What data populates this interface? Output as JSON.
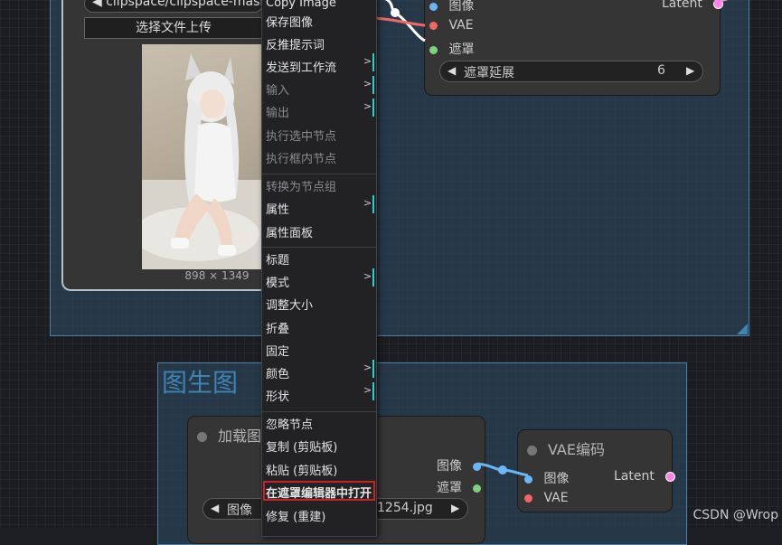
{
  "top_group": {
    "load_node": {
      "file_select": "◀ clipspace/clipspace-mask-",
      "upload_button": "选择文件上传",
      "image_size": "898 × 1349"
    }
  },
  "mask_node": {
    "slot_image": "图像",
    "slot_vae": "VAE",
    "slot_mask": "遮罩",
    "output_latent": "Latent",
    "widget": {
      "label": "遮罩延展",
      "value": "6"
    }
  },
  "bottom_group": {
    "title": "图生图",
    "load_node": {
      "title": "加载图",
      "out_image": "图像",
      "out_mask": "遮罩",
      "image_widget_label": "图像",
      "image_widget_value": "1254.jpg"
    },
    "vae_node": {
      "title": "VAE编码",
      "in_image": "图像",
      "in_vae": "VAE",
      "out_latent": "Latent"
    }
  },
  "context_menu": {
    "items": [
      {
        "label": "Copy Image",
        "disabled": false,
        "submenu": false
      },
      {
        "label": "保存图像",
        "disabled": false,
        "submenu": false
      },
      {
        "label": "反推提示词",
        "disabled": false,
        "submenu": false
      },
      {
        "label": "发送到工作流",
        "disabled": false,
        "submenu": true
      },
      {
        "label": "输入",
        "disabled": true,
        "submenu": true
      },
      {
        "label": "输出",
        "disabled": true,
        "submenu": true
      },
      {
        "label": "执行选中节点",
        "disabled": true,
        "submenu": false
      },
      {
        "label": "执行框内节点",
        "disabled": true,
        "submenu": false
      },
      {
        "label": "转换为节点组",
        "disabled": true,
        "submenu": false
      },
      {
        "label": "属性",
        "disabled": false,
        "submenu": true
      },
      {
        "label": "属性面板",
        "disabled": false,
        "submenu": false
      },
      {
        "label": "标题",
        "disabled": false,
        "submenu": false
      },
      {
        "label": "模式",
        "disabled": false,
        "submenu": true
      },
      {
        "label": "调整大小",
        "disabled": false,
        "submenu": false
      },
      {
        "label": "折叠",
        "disabled": false,
        "submenu": false
      },
      {
        "label": "固定",
        "disabled": false,
        "submenu": false
      },
      {
        "label": "颜色",
        "disabled": false,
        "submenu": true
      },
      {
        "label": "形状",
        "disabled": false,
        "submenu": true
      },
      {
        "label": "忽略节点",
        "disabled": false,
        "submenu": false
      },
      {
        "label": "复制 (剪贴板)",
        "disabled": false,
        "submenu": false
      },
      {
        "label": "粘贴 (剪贴板)",
        "disabled": false,
        "submenu": false
      },
      {
        "label": "在遮罩编辑器中打开",
        "disabled": false,
        "submenu": false,
        "highlighted": true
      },
      {
        "label": "修复 (重建)",
        "disabled": false,
        "submenu": false
      }
    ],
    "submenu_glyph": ">"
  },
  "watermark": "CSDN @Wrop",
  "colors": {
    "image_socket": "#6bb7f5",
    "vae_socket": "#f06767",
    "mask_socket": "#7ed17e",
    "latent_socket": "#ff84e4",
    "group_border": "#4b7ea3",
    "highlight_border": "#c8212a",
    "submenu_marker": "#27d0d0"
  }
}
